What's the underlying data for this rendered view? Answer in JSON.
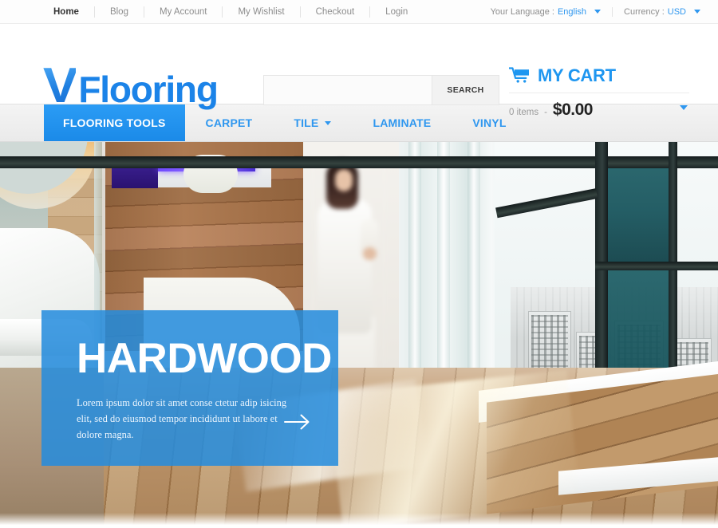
{
  "topbar": {
    "links": [
      {
        "label": "Home",
        "active": true
      },
      {
        "label": "Blog",
        "active": false
      },
      {
        "label": "My Account",
        "active": false
      },
      {
        "label": "My Wishlist",
        "active": false
      },
      {
        "label": "Checkout",
        "active": false
      },
      {
        "label": "Login",
        "active": false
      }
    ],
    "language_label": "Your Language :",
    "language_value": "English",
    "currency_label": "Currency :",
    "currency_value": "USD"
  },
  "header": {
    "logo_mark": "V",
    "logo_word": "Flooring",
    "search": {
      "value": "",
      "placeholder": "",
      "button_label": "SEARCH"
    },
    "cart": {
      "title": "MY CART",
      "items_text": "0 items",
      "separator": "-",
      "total": "$0.00"
    }
  },
  "mainnav": {
    "items": [
      {
        "label": "FLOORING TOOLS",
        "active": true,
        "dropdown": false
      },
      {
        "label": "CARPET",
        "active": false,
        "dropdown": false
      },
      {
        "label": "TILE",
        "active": false,
        "dropdown": true
      },
      {
        "label": "LAMINATE",
        "active": false,
        "dropdown": false
      },
      {
        "label": "VINYL",
        "active": false,
        "dropdown": false
      }
    ]
  },
  "hero": {
    "heading": "HARDWOOD",
    "body": "Lorem ipsum dolor sit amet conse ctetur adip isicing elit, sed do eiusmod tempor incididunt ut labore et dolore magna.",
    "arrow_label": "→"
  },
  "colors": {
    "brand_blue": "#1e96f0",
    "nav_active_blue": "#2b9cf5",
    "caption_blue": "#248cdd",
    "link_blue": "#2f97ef",
    "topbar_text": "#8d8d8d",
    "nav_bg": "#eeeeee"
  }
}
